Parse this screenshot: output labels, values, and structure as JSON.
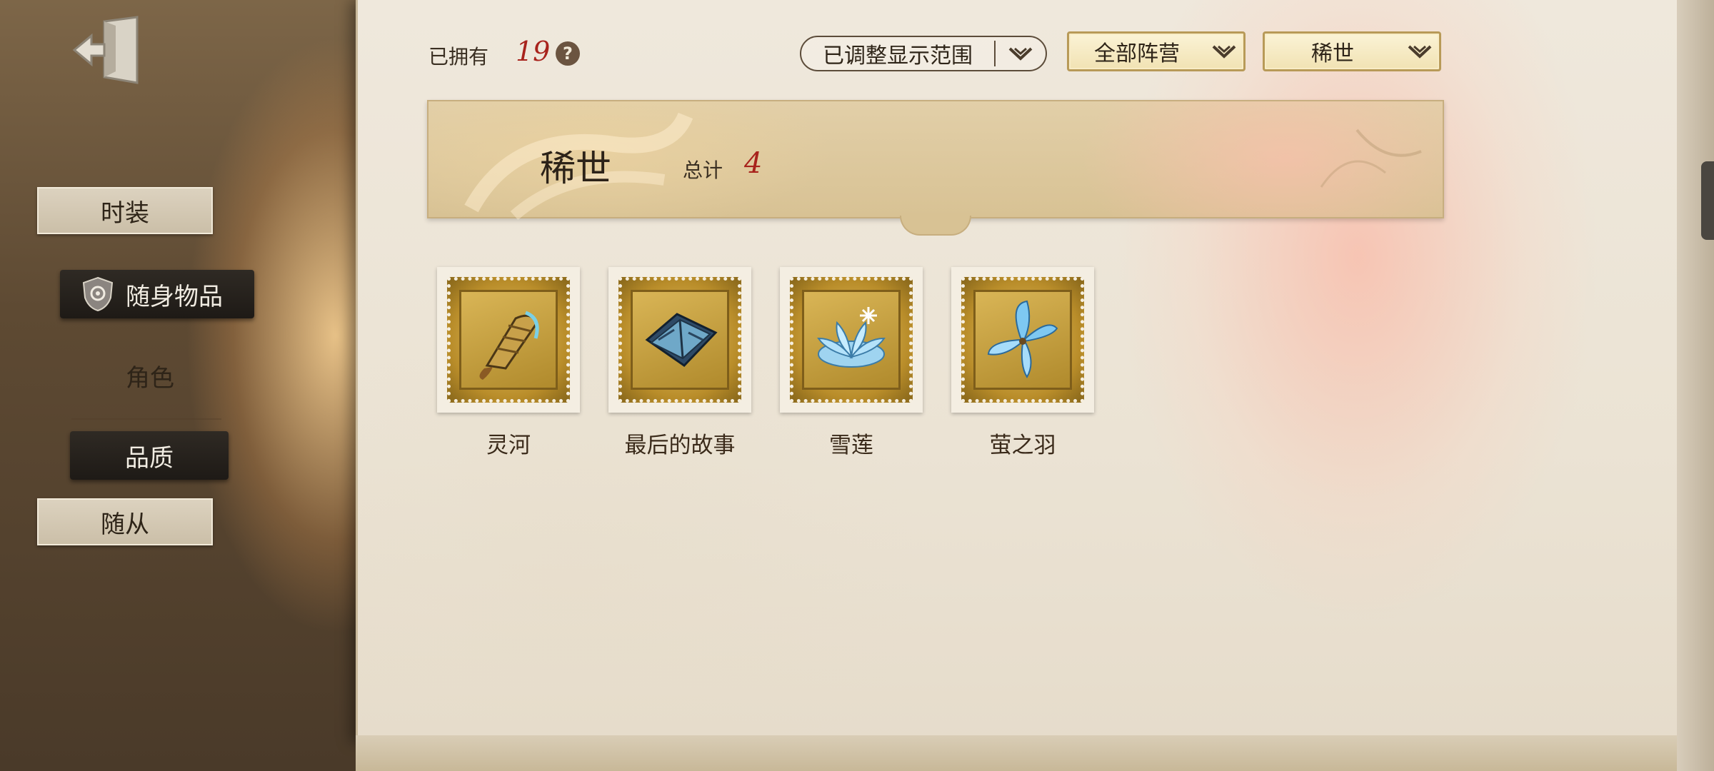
{
  "sidebar": {
    "items": [
      {
        "label": "时装",
        "state": "normal"
      },
      {
        "label": "随身物品",
        "state": "selected"
      },
      {
        "label": "角色",
        "state": "text"
      },
      {
        "label": "品质",
        "state": "selected"
      },
      {
        "label": "随从",
        "state": "normal"
      }
    ]
  },
  "topbar": {
    "owned_label": "已拥有",
    "owned_count": "19",
    "help_icon": "?",
    "range_dropdown": "已调整显示范围",
    "faction_dropdown": "全部阵营",
    "rarity_dropdown": "稀世"
  },
  "category": {
    "title": "稀世",
    "total_label": "总计",
    "total": "4"
  },
  "items": [
    {
      "name": "灵河",
      "icon": "fan-icon"
    },
    {
      "name": "最后的故事",
      "icon": "book-icon"
    },
    {
      "name": "雪莲",
      "icon": "lotus-icon"
    },
    {
      "name": "萤之羽",
      "icon": "butterfly-icon"
    }
  ],
  "colors": {
    "accent_red": "#a8231c",
    "gold_frame": "#b89a58",
    "selected_bg": "#1e1a16"
  }
}
